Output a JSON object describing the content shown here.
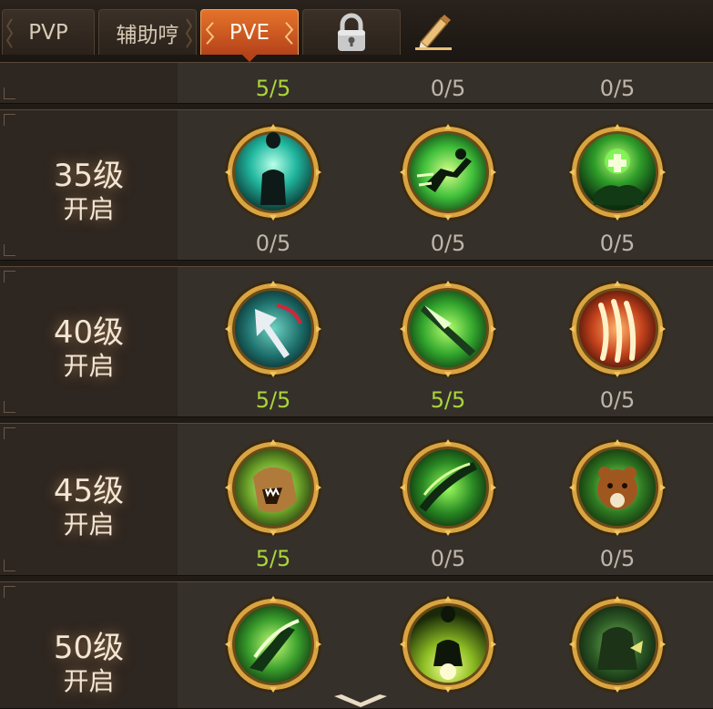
{
  "tabs": [
    {
      "label": "PVP",
      "active": false
    },
    {
      "label": "辅助哼",
      "active": false
    },
    {
      "label": "PVE",
      "active": true
    },
    {
      "label": "",
      "icon": "lock-icon",
      "active": false
    },
    {
      "label": "",
      "icon": "pencil-icon",
      "active": false
    }
  ],
  "top_partial_row": {
    "counts": [
      "5/5",
      "0/5",
      "0/5"
    ],
    "maxed": [
      true,
      false,
      false
    ]
  },
  "rows": [
    {
      "level": "35级",
      "unlock": "开启",
      "skills": [
        {
          "icon": "silhouette-figure-icon",
          "count": "0/5",
          "maxed": false
        },
        {
          "icon": "dashing-runner-icon",
          "count": "0/5",
          "maxed": false
        },
        {
          "icon": "healing-hand-icon",
          "count": "0/5",
          "maxed": false
        }
      ]
    },
    {
      "level": "40级",
      "unlock": "开启",
      "skills": [
        {
          "icon": "spear-slash-icon",
          "count": "5/5",
          "maxed": true
        },
        {
          "icon": "green-blade-icon",
          "count": "5/5",
          "maxed": true
        },
        {
          "icon": "claw-strike-icon",
          "count": "0/5",
          "maxed": false
        }
      ]
    },
    {
      "level": "45级",
      "unlock": "开启",
      "skills": [
        {
          "icon": "beast-roar-icon",
          "count": "5/5",
          "maxed": true
        },
        {
          "icon": "vine-whip-icon",
          "count": "0/5",
          "maxed": false
        },
        {
          "icon": "bear-guardian-icon",
          "count": "0/5",
          "maxed": false
        }
      ]
    },
    {
      "level": "50级",
      "unlock": "开启",
      "skills": [
        {
          "icon": "green-strike-icon",
          "count": "",
          "maxed": false
        },
        {
          "icon": "glowing-silhouette-icon",
          "count": "",
          "maxed": false
        },
        {
          "icon": "forest-spirit-icon",
          "count": "",
          "maxed": false
        }
      ]
    }
  ],
  "colors": {
    "maxed_count": "#a9d63b",
    "count": "#bfb6ab",
    "active_tab": "#e5732a",
    "frame_gold": "#d9a441",
    "skill_green": "#3fbf3a"
  }
}
